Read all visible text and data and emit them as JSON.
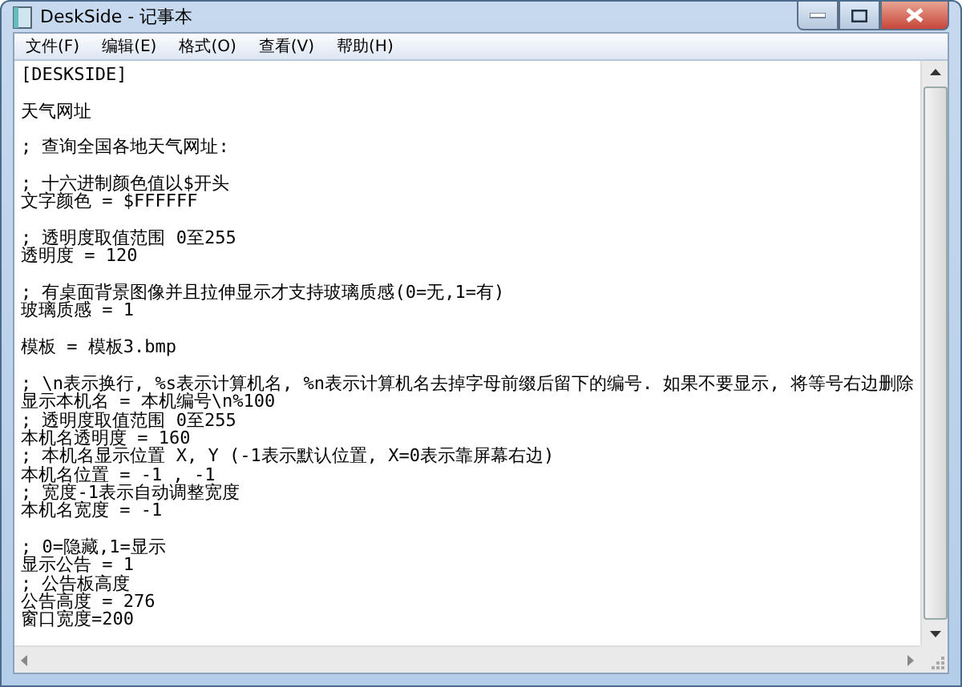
{
  "window": {
    "title": "DeskSide - 记事本"
  },
  "menu": [
    "文件(F)",
    "编辑(E)",
    "格式(O)",
    "查看(V)",
    "帮助(H)"
  ],
  "document": {
    "blocks": [
      [
        "[DESKSIDE]"
      ],
      [
        "天气网址"
      ],
      [
        "; 查询全国各地天气网址:"
      ],
      [
        "; 十六进制颜色值以$开头",
        "文字颜色 = $FFFFFF"
      ],
      [
        "; 透明度取值范围 0至255",
        "透明度 = 120"
      ],
      [
        "; 有桌面背景图像并且拉伸显示才支持玻璃质感(0=无,1=有)",
        "玻璃质感 = 1"
      ],
      [
        "模板 = 模板3.bmp"
      ],
      [
        "; \\n表示换行, %s表示计算机名, %n表示计算机名去掉字母前缀后留下的编号. 如果不要显示, 将等号右边删除",
        "显示本机名 = 本机编号\\n%100",
        "; 透明度取值范围 0至255",
        "本机名透明度 = 160",
        "; 本机名显示位置 X, Y (-1表示默认位置, X=0表示靠屏幕右边)",
        "本机名位置 = -1 , -1",
        "; 宽度-1表示自动调整宽度",
        "本机名宽度 = -1"
      ],
      [
        "; 0=隐藏,1=显示",
        "显示公告 = 1",
        "; 公告板高度",
        "公告高度 = 276",
        "窗口宽度=200"
      ]
    ]
  }
}
